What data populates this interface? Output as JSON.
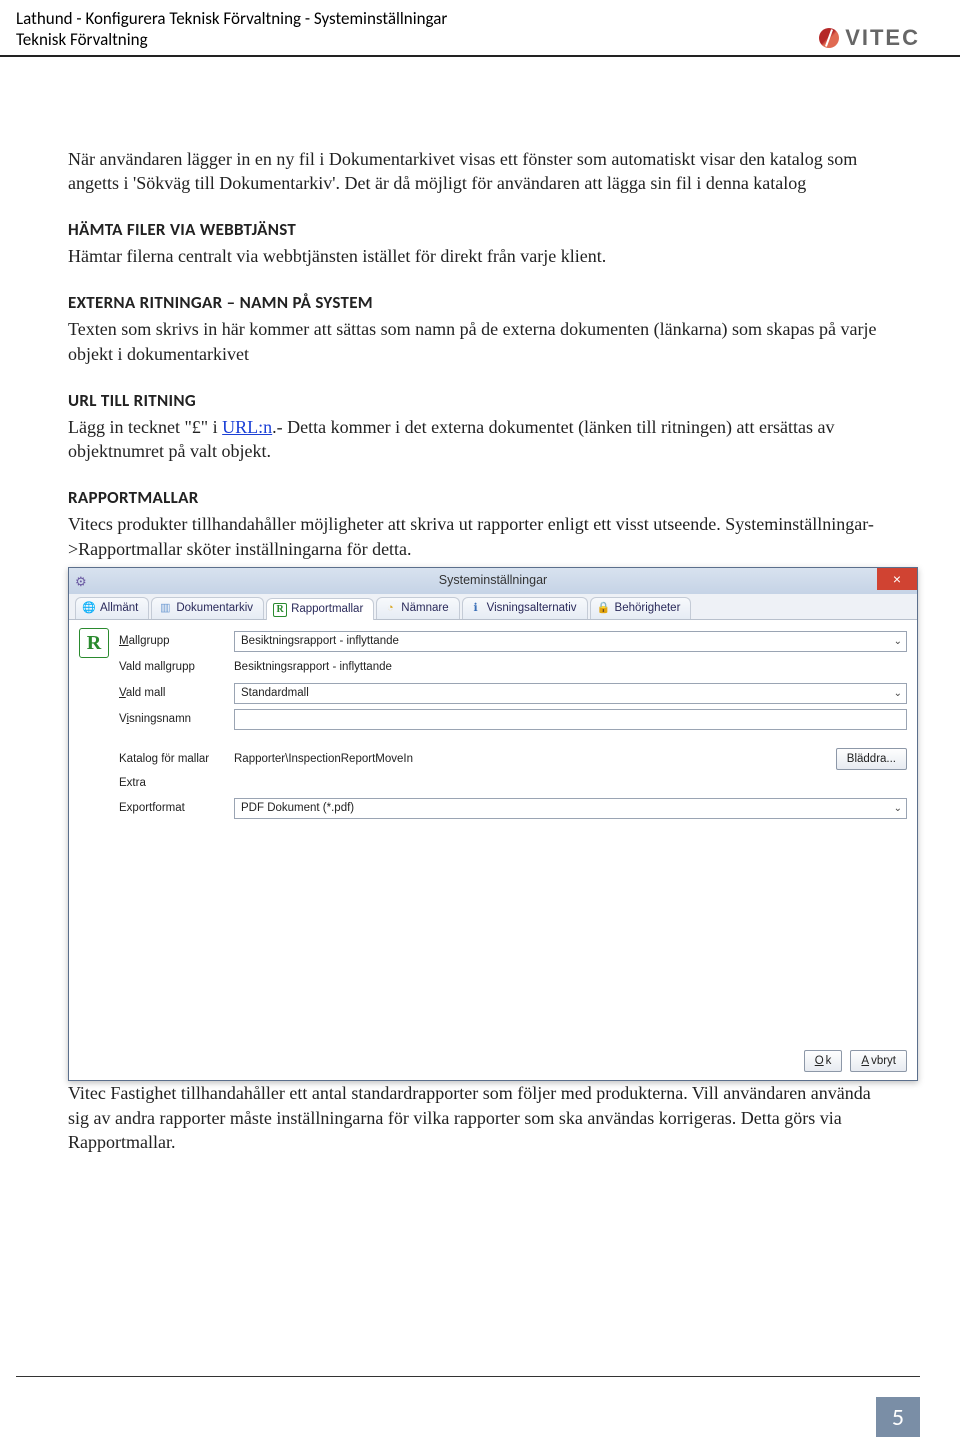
{
  "header": {
    "line1": "Lathund - Konfigurera Teknisk Förvaltning - Systeminställningar",
    "line2": "Teknisk Förvaltning",
    "brand": "VITEC"
  },
  "doc": {
    "intro1": "När användaren lägger in en ny fil i Dokumentarkivet visas ett fönster som automatiskt visar den katalog som angetts i 'Sökväg till Dokumentarkiv'. Det är då möjligt för användaren att lägga sin fil i denna katalog",
    "h_hamta": "HÄMTA FILER VIA WEBBTJÄNST",
    "p_hamta": "Hämtar filerna centralt via webbtjänsten istället för direkt från varje klient.",
    "h_ext": "EXTERNA RITNINGAR – NAMN PÅ SYSTEM",
    "p_ext": "Texten som skrivs in här kommer att sättas som namn på de externa dokumenten (länkarna) som skapas på varje objekt i dokumentarkivet",
    "h_url": "URL TILL RITNING",
    "p_url_pre": "Lägg in tecknet \"£\" i ",
    "p_url_link": "URL:n",
    "p_url_post": ".- Detta kommer i det externa dokumentet (länken till ritningen) att ersättas av objektnumret på valt objekt.",
    "h_rap": "RAPPORTMALLAR",
    "p_rap": "Vitecs produkter tillhandahåller möjligheter att skriva ut rapporter enligt ett visst utseende. Systeminställningar->Rapportmallar sköter inställningarna för detta.",
    "outro": "Vitec Fastighet tillhandahåller ett antal standardrapporter som följer med produkterna. Vill användaren använda sig av andra rapporter måste inställningarna för vilka rapporter som ska användas korrigeras. Detta görs via Rapportmallar.",
    "page_number": "5"
  },
  "window": {
    "title": "Systeminställningar",
    "tabs": [
      "Allmänt",
      "Dokumentarkiv",
      "Rapportmallar",
      "Nämnare",
      "Visningsalternativ",
      "Behörigheter"
    ],
    "labels": {
      "mallgrupp": "Mallgrupp",
      "vald_mallgrupp": "Vald mallgrupp",
      "vald_mall": "Vald mall",
      "visningsnamn": "Visningsnamn",
      "katalog": "Katalog för mallar",
      "extra": "Extra",
      "exportformat": "Exportformat"
    },
    "values": {
      "mallgrupp": "Besiktningsrapport - inflyttande",
      "vald_mallgrupp": "Besiktningsrapport - inflyttande",
      "vald_mall": "Standardmall",
      "visningsnamn": "",
      "katalog": "Rapporter\\InspectionReportMoveIn",
      "exportformat": "PDF Dokument (*.pdf)"
    },
    "buttons": {
      "browse": "Bläddra...",
      "ok": "Ok",
      "cancel": "Avbryt"
    }
  }
}
